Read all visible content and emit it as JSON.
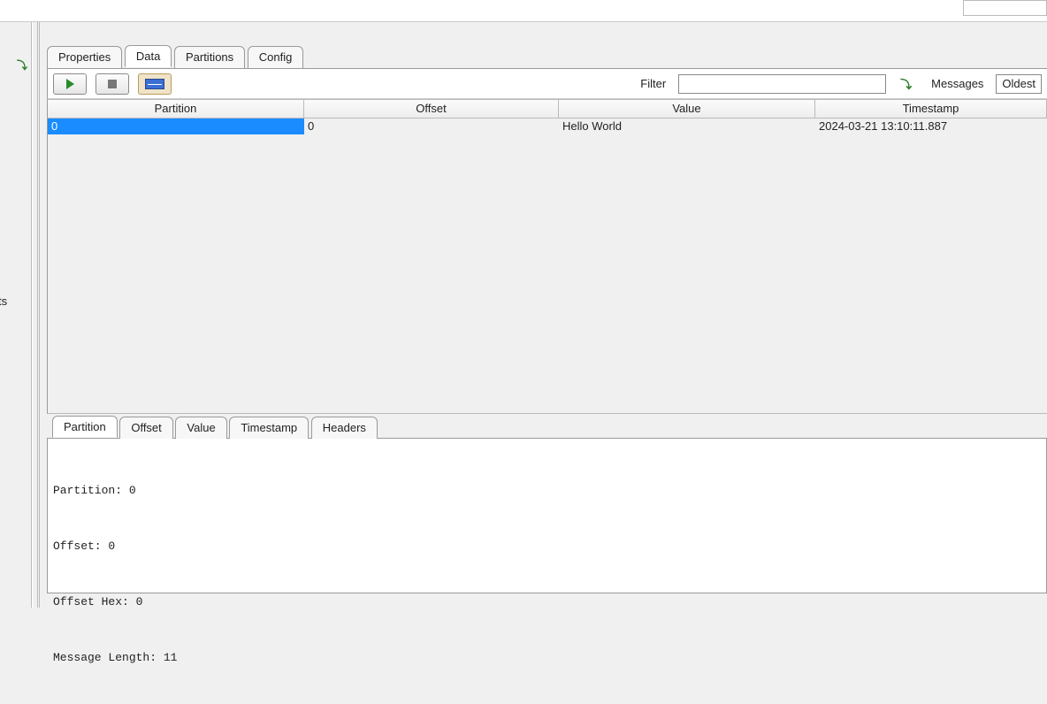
{
  "left": {
    "fragment": "ts"
  },
  "main_tabs": {
    "properties": "Properties",
    "data": "Data",
    "partitions": "Partitions",
    "config": "Config",
    "active": "data"
  },
  "toolbar": {
    "filter_label": "Filter",
    "filter_value": "",
    "messages_label": "Messages",
    "messages_mode": "Oldest"
  },
  "columns": {
    "partition": "Partition",
    "offset": "Offset",
    "value": "Value",
    "timestamp": "Timestamp"
  },
  "rows": [
    {
      "partition": "0",
      "offset": "0",
      "value": "Hello World",
      "timestamp": "2024-03-21 13:10:11.887"
    }
  ],
  "detail_tabs": {
    "partition": "Partition",
    "offset": "Offset",
    "value": "Value",
    "timestamp": "Timestamp",
    "headers": "Headers",
    "active": "partition"
  },
  "detail": {
    "partition_line": "Partition: 0",
    "offset_line": "Offset: 0",
    "offsethex_line": "Offset Hex: 0",
    "msglen_line": "Message Length: 11"
  }
}
